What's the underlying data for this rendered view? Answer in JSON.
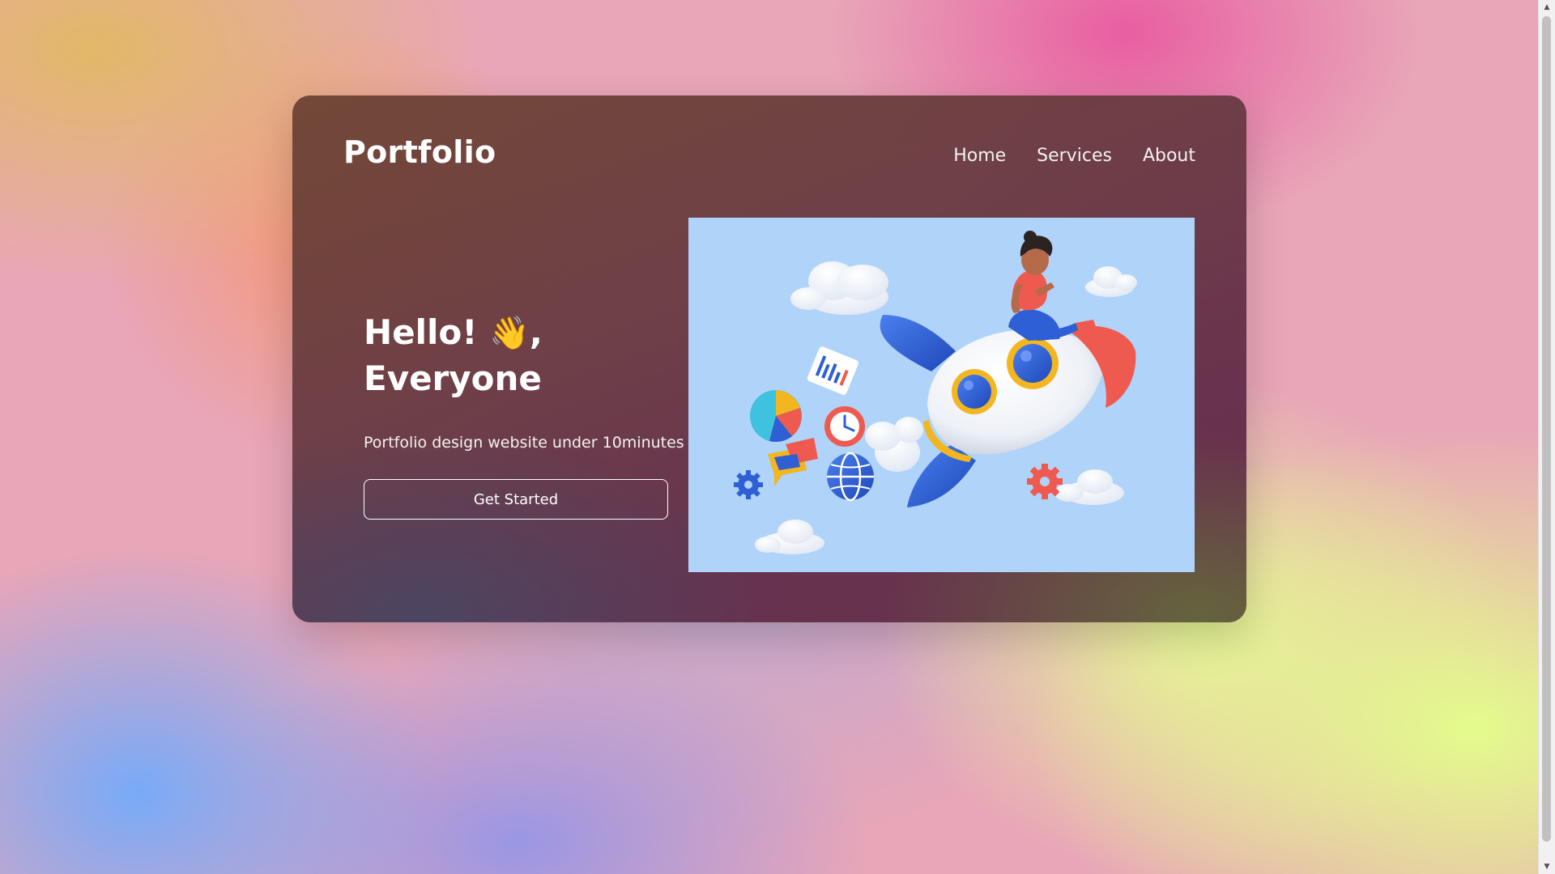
{
  "header": {
    "logo": "Portfolio",
    "nav": [
      {
        "label": "Home"
      },
      {
        "label": "Services"
      },
      {
        "label": "About"
      }
    ]
  },
  "hero": {
    "title_line1": "Hello!",
    "wave_emoji": "👋",
    "title_comma": ",",
    "title_line2": "Everyone",
    "subtitle": "Portfolio design website under 10minutes",
    "cta_label": "Get Started"
  },
  "colors": {
    "illustration_bg": "#b0d3fa",
    "rocket_blue": "#2f5fd4",
    "rocket_red": "#ee5a4f",
    "text": "#ffffff"
  },
  "icons": [
    "rocket-illustration",
    "cloud-icon",
    "pie-chart-icon",
    "clock-icon",
    "globe-icon",
    "gear-icon",
    "document-chart-icon",
    "chat-bubble-icon",
    "waving-hand-icon",
    "scroll-up-arrow-icon",
    "scroll-down-arrow-icon"
  ]
}
